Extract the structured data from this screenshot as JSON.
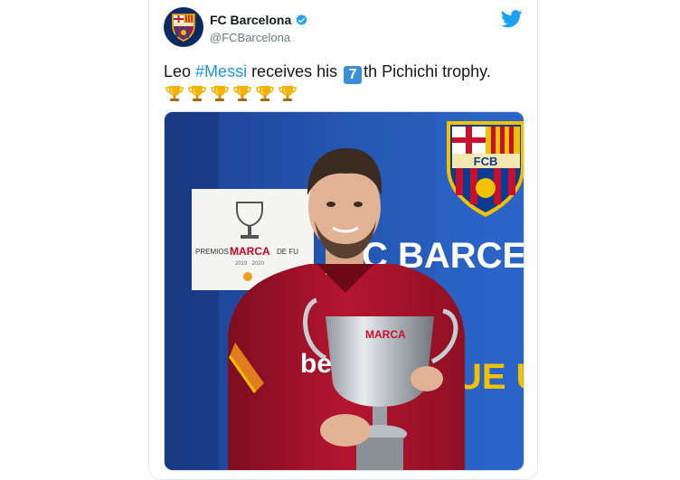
{
  "tweet": {
    "display_name": "FC Barcelona",
    "handle": "@FCBarcelona",
    "text_prefix": "Leo ",
    "hashtag": "#Messi",
    "text_mid": " receives his ",
    "keycap": "7",
    "text_suffix": "th Pichichi trophy.",
    "trophy_emoji_count": 6
  },
  "media": {
    "backdrop_text": "C BARCE",
    "backdrop_text2": "UE U",
    "crest_text": "FCB",
    "sign_line1": "PREMIOS",
    "sign_brand": "MARCA",
    "sign_line1_end": "DE FU",
    "sign_year": "2019 · 2020",
    "shirt_text": "be",
    "cup_label": "MARCA"
  },
  "colors": {
    "link": "#1b95e0",
    "keycap": "#3a8fd6",
    "backdrop_blue": "#1f4fa8",
    "shirt_red": "#a8122a",
    "twitter_blue": "#1da1f2"
  }
}
